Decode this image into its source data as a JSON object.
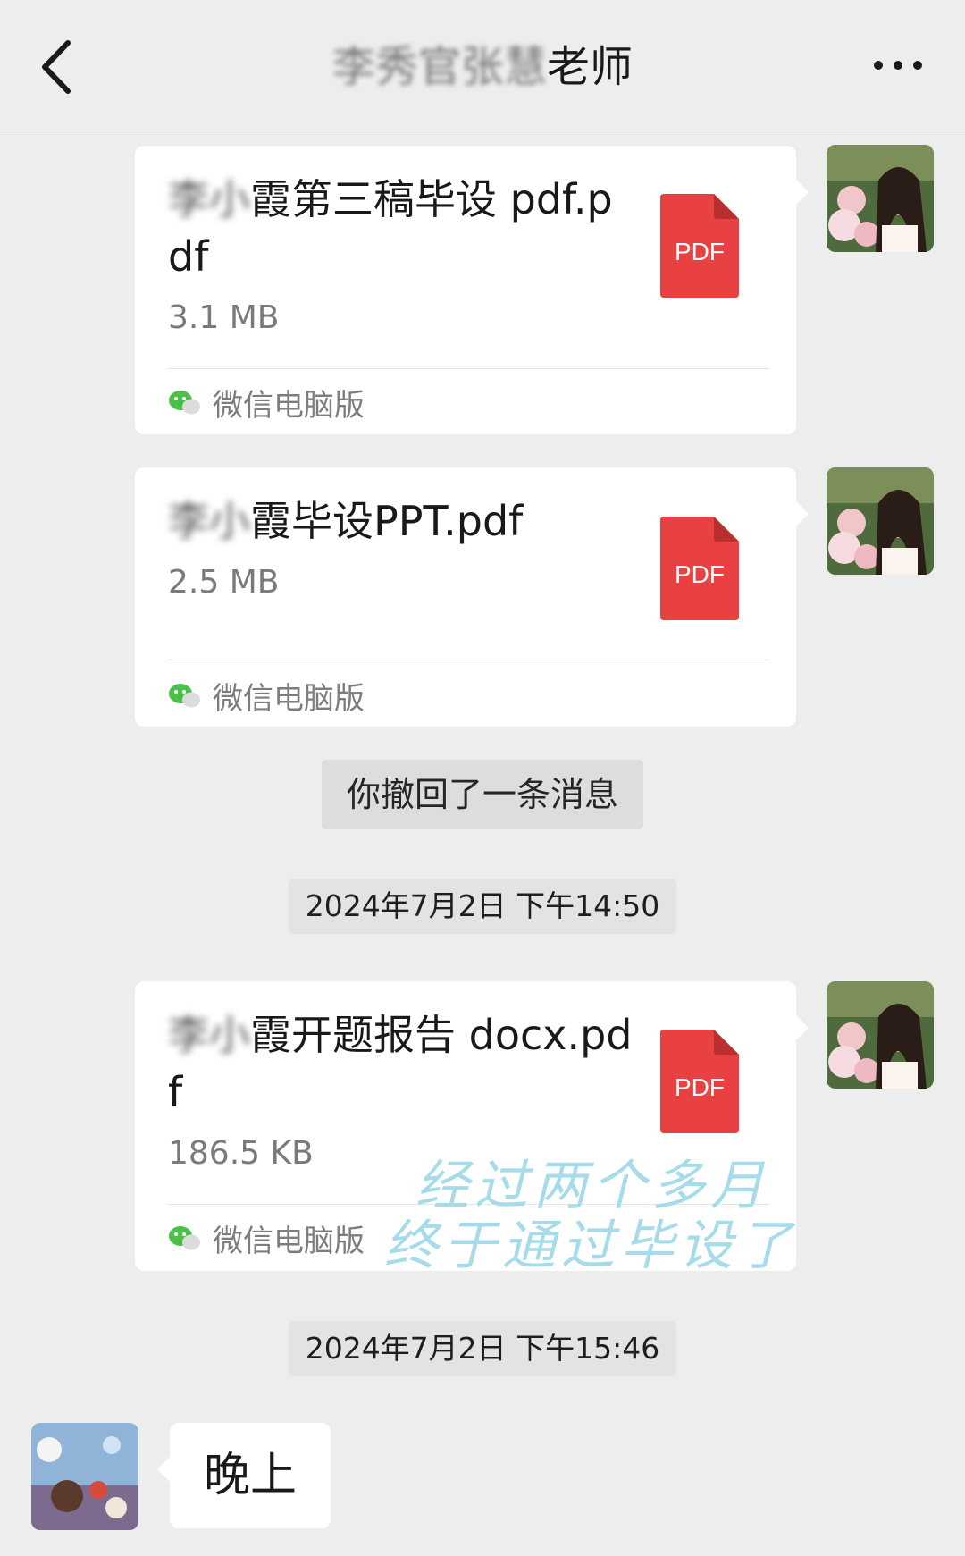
{
  "header": {
    "title_prefix": "李秀官张慧",
    "title_suffix": "老师"
  },
  "messages": {
    "file1": {
      "name_prefix": "李小",
      "name_rest": "霞第三稿毕设 pdf.pdf",
      "size": "3.1 MB",
      "icon_label": "PDF",
      "source": "微信电脑版"
    },
    "file2": {
      "name_prefix": "李小",
      "name_rest": "霞毕设PPT.pdf",
      "size": "2.5 MB",
      "icon_label": "PDF",
      "source": "微信电脑版"
    },
    "recall_notice": "你撤回了一条消息",
    "time1": "2024年7月2日 下午14:50",
    "file3": {
      "name_prefix": "李小",
      "name_rest": "霞开题报告 docx.pdf",
      "size": "186.5 KB",
      "icon_label": "PDF",
      "source": "微信电脑版"
    },
    "overlay_line1": "经过两个多月",
    "overlay_line2": "终于通过毕设了",
    "time2": "2024年7月2日 下午15:46",
    "reply": "晚上"
  },
  "colors": {
    "background": "#ededed",
    "pdf_red": "#e94141",
    "wechat_green": "#4ac04a",
    "overlay_text": "#a6dcea"
  },
  "icons": [
    "back-arrow-icon",
    "more-dots-icon",
    "pdf-file-icon",
    "wechat-icon"
  ]
}
